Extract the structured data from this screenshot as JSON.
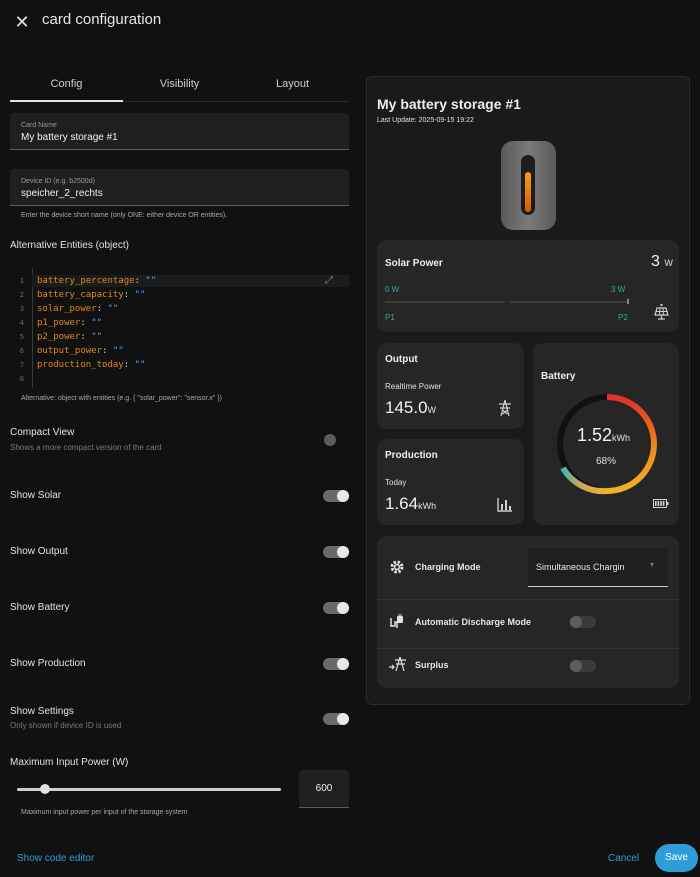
{
  "dialog": {
    "title": "card configuration",
    "close_icon": "close-icon"
  },
  "tabs": [
    {
      "label": "Config",
      "active": true
    },
    {
      "label": "Visibility"
    },
    {
      "label": "Layout"
    }
  ],
  "fields": {
    "card_name": {
      "label": "Card Name",
      "value": "My battery storage #1"
    },
    "device_id": {
      "label": "Device ID (e.g. b2500d)",
      "value": "speicher_2_rechts",
      "helper": "Enter the device short name (only ONE: either device OR entities)."
    }
  },
  "alt_entities": {
    "title": "Alternative Entities (object)",
    "lines": [
      {
        "n": "1",
        "key": "battery_percentage",
        "val": "\"\""
      },
      {
        "n": "2",
        "key": "battery_capacity",
        "val": "\"\""
      },
      {
        "n": "3",
        "key": "solar_power",
        "val": "\"\""
      },
      {
        "n": "4",
        "key": "p1_power",
        "val": "\"\""
      },
      {
        "n": "5",
        "key": "p2_power",
        "val": "\"\""
      },
      {
        "n": "6",
        "key": "output_power",
        "val": "\"\""
      },
      {
        "n": "7",
        "key": "production_today",
        "val": "\"\""
      },
      {
        "n": "8",
        "key": "",
        "val": ""
      }
    ],
    "helper": "Alternative: object with entities (e.g. { \"solar_power\": \"sensor.x\" })"
  },
  "toggles": {
    "compact_view": {
      "label": "Compact View",
      "sub": "Shows a more compact version of the card",
      "on": false
    },
    "show_solar": {
      "label": "Show Solar",
      "on": true
    },
    "show_output": {
      "label": "Show Output",
      "on": true
    },
    "show_battery": {
      "label": "Show Battery",
      "on": true
    },
    "show_production": {
      "label": "Show Production",
      "on": true
    },
    "show_settings": {
      "label": "Show Settings",
      "sub": "Only shown if device ID is used",
      "on": true
    }
  },
  "max_input": {
    "label": "Maximum Input Power (W)",
    "value": "600",
    "slider_fraction": 0.1,
    "helper": "Maximum input power per input of the storage system"
  },
  "footer": {
    "code_editor": "Show code editor",
    "cancel": "Cancel",
    "save": "Save"
  },
  "preview": {
    "title": "My battery storage #1",
    "last_update": "Last Update: 2025-09-15 19:22",
    "solar": {
      "title": "Solar Power",
      "value": "3",
      "unit": "W",
      "p1_value": "0 W",
      "p2_value": "3 W",
      "p1_label": "P1",
      "p2_label": "P2"
    },
    "output": {
      "title": "Output",
      "sub": "Realtime Power",
      "value": "145.0",
      "unit": "W"
    },
    "production": {
      "title": "Production",
      "sub": "Today",
      "value": "1.64",
      "unit": "kWh"
    },
    "battery": {
      "title": "Battery",
      "value": "1.52",
      "unit": "kWh",
      "percent": "68%",
      "percent_value": 68
    },
    "settings": {
      "charging_mode": {
        "label": "Charging Mode",
        "value": "Simultaneous Chargin"
      },
      "auto_discharge": {
        "label": "Automatic Discharge Mode",
        "on": false
      },
      "surplus": {
        "label": "Surplus",
        "on": false
      }
    },
    "colors": {
      "accent_teal": "#38a5a0",
      "battery_orange": "#e0891a",
      "link_blue": "#2f9dda"
    }
  }
}
